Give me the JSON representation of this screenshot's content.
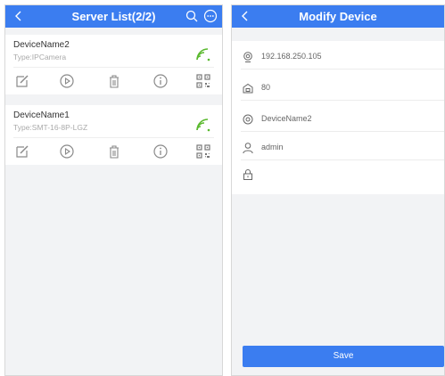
{
  "left": {
    "title": "Server List(2/2)",
    "devices": [
      {
        "name": "DeviceName2",
        "type": "Type:IPCamera"
      },
      {
        "name": "DeviceName1",
        "type": "Type:SMT-16-8P-LGZ"
      }
    ]
  },
  "right": {
    "title": "Modify Device",
    "fields": [
      {
        "icon": "globe-icon",
        "value": "192.168.250.105"
      },
      {
        "icon": "port-icon",
        "value": "80"
      },
      {
        "icon": "device-icon",
        "value": "DeviceName2"
      },
      {
        "icon": "user-icon",
        "value": "admin"
      },
      {
        "icon": "lock-icon",
        "value": ""
      }
    ],
    "save_label": "Save"
  },
  "colors": {
    "accent": "#3b7df0",
    "signal": "#5ab92e",
    "background": "#f2f3f5"
  }
}
